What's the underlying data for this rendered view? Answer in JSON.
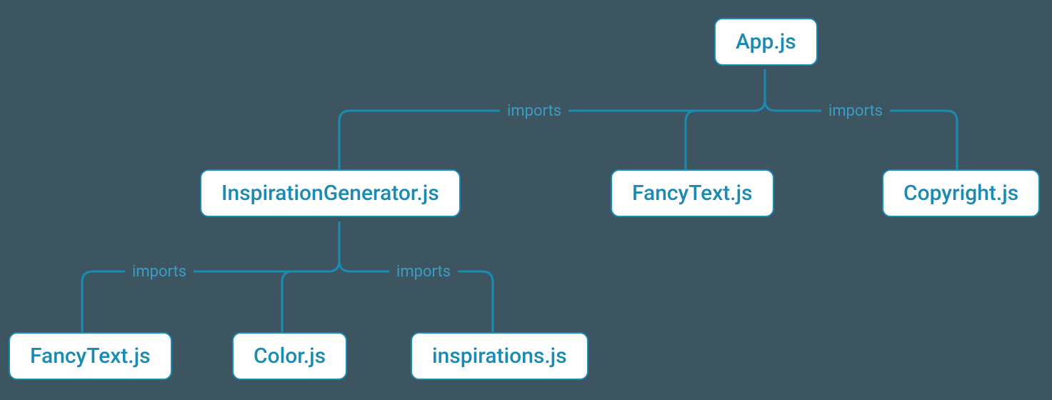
{
  "nodes": {
    "app": "App.js",
    "inspirationGenerator": "InspirationGenerator.js",
    "fancyText1": "FancyText.js",
    "copyright": "Copyright.js",
    "fancyText2": "FancyText.js",
    "color": "Color.js",
    "inspirations": "inspirations.js"
  },
  "edgeLabels": {
    "imports1": "imports",
    "imports2": "imports",
    "imports3": "imports",
    "imports4": "imports"
  },
  "chart_data": {
    "type": "tree",
    "title": "",
    "nodes": [
      {
        "id": "app",
        "label": "App.js",
        "level": 0
      },
      {
        "id": "inspirationGenerator",
        "label": "InspirationGenerator.js",
        "level": 1
      },
      {
        "id": "fancyText1",
        "label": "FancyText.js",
        "level": 1
      },
      {
        "id": "copyright",
        "label": "Copyright.js",
        "level": 1
      },
      {
        "id": "fancyText2",
        "label": "FancyText.js",
        "level": 2
      },
      {
        "id": "color",
        "label": "Color.js",
        "level": 2
      },
      {
        "id": "inspirations",
        "label": "inspirations.js",
        "level": 2
      }
    ],
    "edges": [
      {
        "from": "app",
        "to": "inspirationGenerator",
        "label": "imports"
      },
      {
        "from": "app",
        "to": "fancyText1",
        "label": ""
      },
      {
        "from": "app",
        "to": "copyright",
        "label": "imports"
      },
      {
        "from": "inspirationGenerator",
        "to": "fancyText2",
        "label": "imports"
      },
      {
        "from": "inspirationGenerator",
        "to": "color",
        "label": ""
      },
      {
        "from": "inspirationGenerator",
        "to": "inspirations",
        "label": "imports"
      }
    ]
  }
}
